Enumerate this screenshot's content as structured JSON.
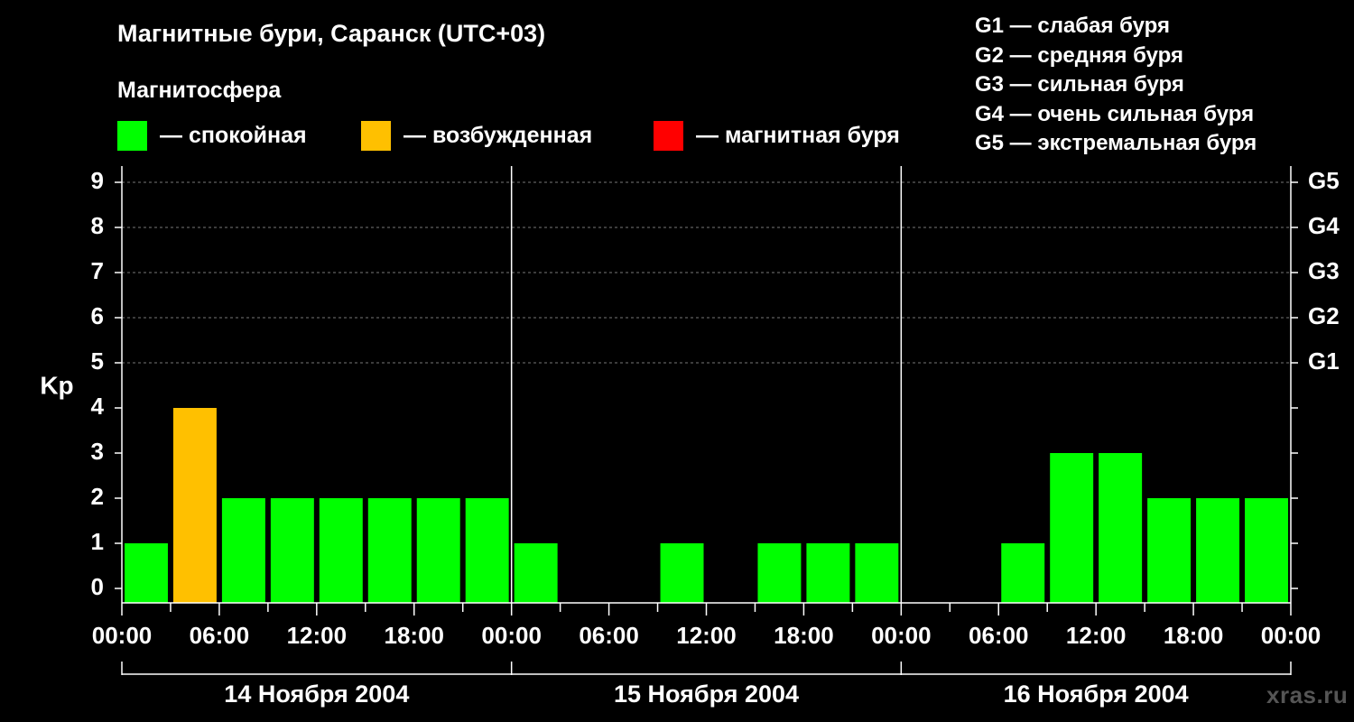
{
  "header": {
    "title": "Магнитные бури, Саранск (UTC+03)",
    "subtitle": "Магнитосфера"
  },
  "legend": [
    {
      "label": "— спокойная",
      "color": "#00ff00"
    },
    {
      "label": "— возбужденная",
      "color": "#ffc000"
    },
    {
      "label": "— магнитная буря",
      "color": "#ff0000"
    }
  ],
  "g_legend": [
    "G1 — слабая буря",
    "G2 — средняя буря",
    "G3 — сильная буря",
    "G4 — очень сильная буря",
    "G5 — экстремальная буря"
  ],
  "watermark": "xras.ru",
  "chart_data": {
    "type": "bar",
    "ylabel": "Kp",
    "ylim": [
      0,
      9
    ],
    "yticks": [
      0,
      1,
      2,
      3,
      4,
      5,
      6,
      7,
      8,
      9
    ],
    "right_axis_labels": [
      {
        "kp": 5,
        "label": "G1"
      },
      {
        "kp": 6,
        "label": "G2"
      },
      {
        "kp": 7,
        "label": "G3"
      },
      {
        "kp": 8,
        "label": "G4"
      },
      {
        "kp": 9,
        "label": "G5"
      }
    ],
    "x_tick_labels": [
      "00:00",
      "06:00",
      "12:00",
      "18:00",
      "00:00",
      "06:00",
      "12:00",
      "18:00",
      "00:00",
      "06:00",
      "12:00",
      "18:00",
      "00:00"
    ],
    "days": [
      "14 Ноября 2004",
      "15 Ноября 2004",
      "16 Ноября 2004"
    ],
    "interval_hours": 3,
    "values": [
      1,
      4,
      2,
      2,
      2,
      2,
      2,
      2,
      1,
      0,
      0,
      1,
      0,
      1,
      1,
      1,
      0,
      0,
      1,
      3,
      3,
      2,
      2,
      2
    ],
    "level_colors": {
      "quiet": "#00ff00",
      "active": "#ffc000",
      "storm": "#ff0000"
    },
    "grid": true
  }
}
